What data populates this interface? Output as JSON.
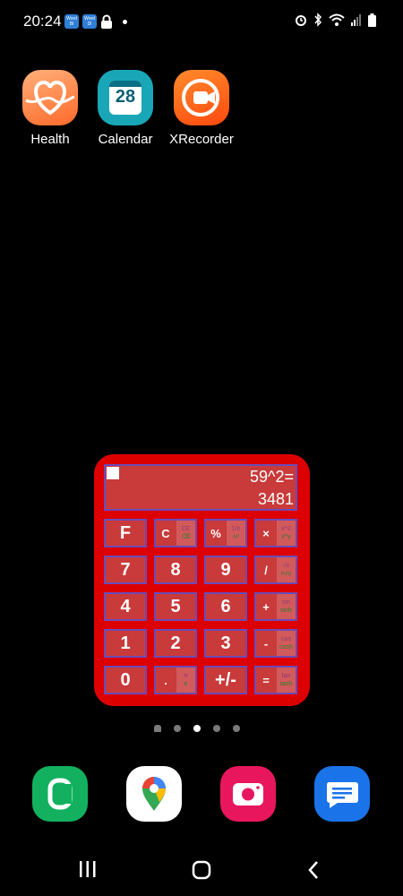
{
  "status_bar": {
    "time": "20:24",
    "notif1": "Word Bl",
    "notif2": "Word Dl"
  },
  "apps": [
    {
      "label": "Health",
      "icon": "health-icon"
    },
    {
      "label": "Calendar",
      "icon": "calendar-icon",
      "date": "28"
    },
    {
      "label": "XRecorder",
      "icon": "xrecorder-icon"
    }
  ],
  "calculator": {
    "expression": "59^2=",
    "result": "3481",
    "keys": [
      {
        "main": "F"
      },
      {
        "main": "C",
        "s1": "CE",
        "s2": "⌫"
      },
      {
        "main": "%",
        "s1": "1/n",
        "s2": "n²"
      },
      {
        "main": "×",
        "s1": "x^2",
        "s2": "x^y"
      },
      {
        "main": "7"
      },
      {
        "main": "8"
      },
      {
        "main": "9"
      },
      {
        "main": "/",
        "s1": "√x",
        "s2": "n√x"
      },
      {
        "main": "4"
      },
      {
        "main": "5"
      },
      {
        "main": "6"
      },
      {
        "main": "+",
        "s1": "sin",
        "s2": "sinh"
      },
      {
        "main": "1"
      },
      {
        "main": "2"
      },
      {
        "main": "3"
      },
      {
        "main": "-",
        "s1": "cos",
        "s2": "cosh"
      },
      {
        "main": "0"
      },
      {
        "main": ".",
        "s1": "π",
        "s2": "e"
      },
      {
        "main": "+/-"
      },
      {
        "main": "=",
        "s1": "tan",
        "s2": "tanh"
      }
    ]
  },
  "page_indicator": {
    "pages": 5,
    "current": 3
  },
  "dock": [
    {
      "icon": "phone-icon"
    },
    {
      "icon": "maps-icon"
    },
    {
      "icon": "camera-icon"
    },
    {
      "icon": "messages-icon"
    }
  ],
  "colors": {
    "widget_bg": "#dd0000",
    "key_bg": "#c93a3a",
    "key_border": "#6b4bb8"
  }
}
